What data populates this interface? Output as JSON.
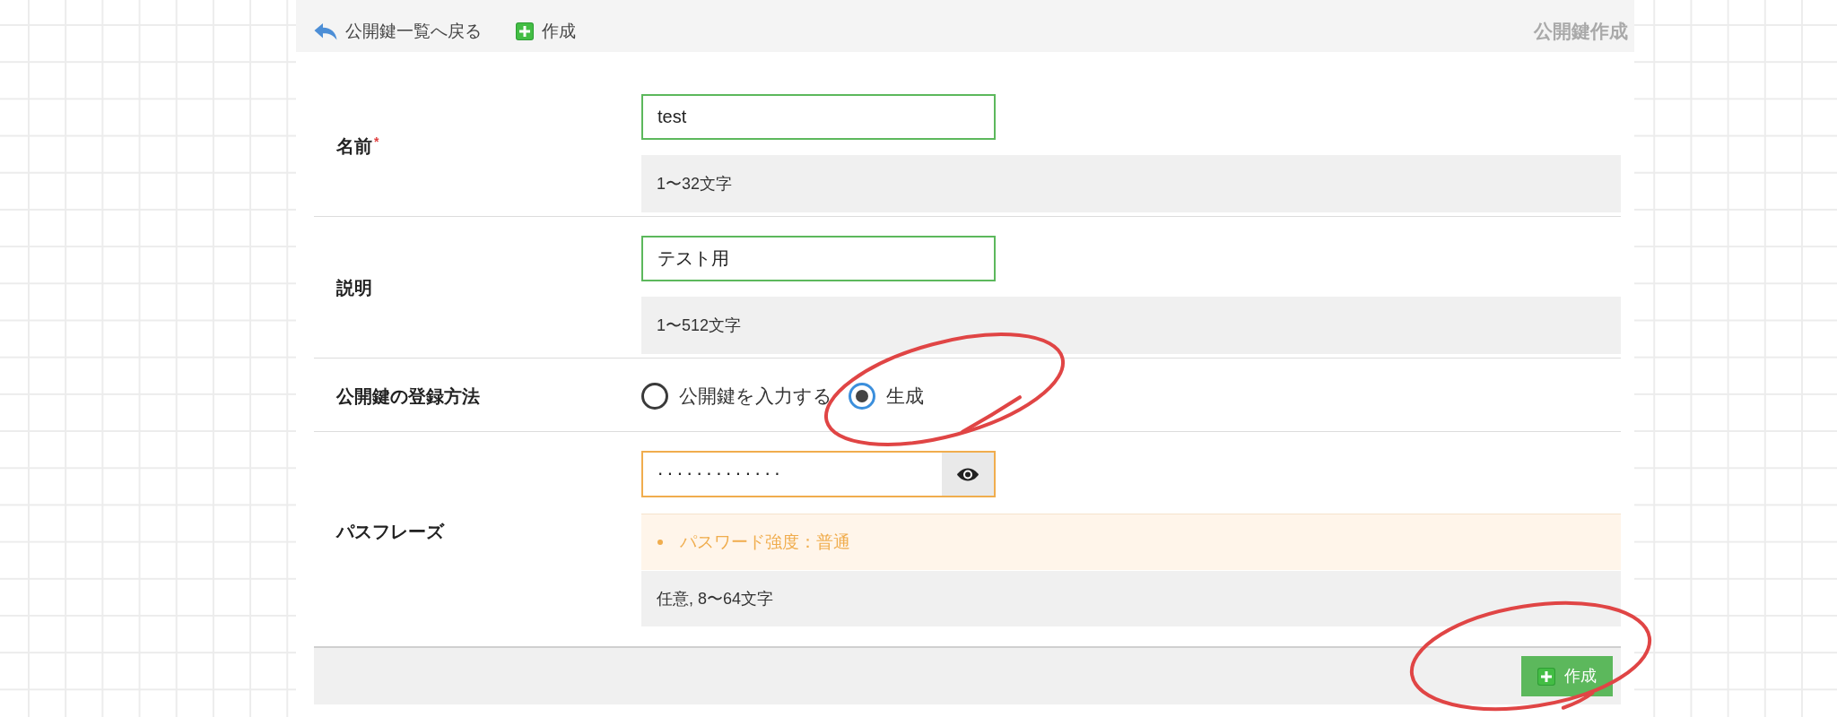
{
  "toolbar": {
    "back_link": "公開鍵一覧へ戻る",
    "create_link": "作成",
    "title": "公開鍵作成"
  },
  "form": {
    "rows": [
      {
        "kind": "text",
        "label": "名前",
        "required_mark": "*",
        "value": "test",
        "warning": false,
        "help": "1〜32文字"
      },
      {
        "kind": "text",
        "label": "説明",
        "value": "テスト用",
        "warning": false,
        "help": "1〜512文字"
      },
      {
        "kind": "radio",
        "label": "公開鍵の登録方法",
        "options": [
          {
            "label": "公開鍵を入力する",
            "selected": false,
            "circled": false
          },
          {
            "label": "生成",
            "selected": true,
            "circled": true
          }
        ]
      },
      {
        "kind": "password",
        "label": "パスフレーズ",
        "value": "·············",
        "warning": true,
        "messages": [
          "パスワード強度：普通"
        ],
        "help": "任意, 8〜64文字"
      }
    ]
  },
  "footer": {
    "submit": {
      "label": "作成",
      "circled": true
    }
  }
}
